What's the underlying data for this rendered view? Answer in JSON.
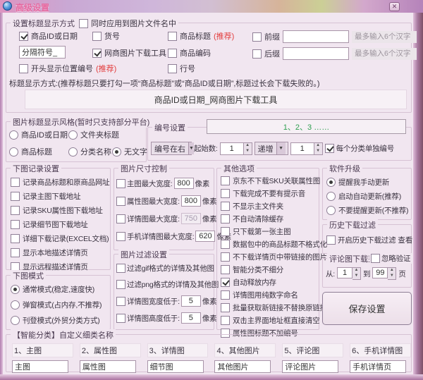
{
  "colors": {
    "accent_red": "#e23b3b",
    "accent_green": "#2e9e4f"
  },
  "window": {
    "title": "高级设置",
    "close_glyph": "✕"
  },
  "g1": {
    "legend": "设置标题显示方式",
    "apply": "同时应用到图片文件名中",
    "r1c1": "商品ID或日期",
    "r1c2": "货号",
    "r1c3": "商品标题",
    "r1rec": "(推荐)",
    "r1c4": "前缀",
    "r1hint": "最多输入6个汉字",
    "r2c1": "分隔符号_",
    "r2c2": "网商图片下载工具",
    "r2c3": "商品编码",
    "r2c4": "后缀",
    "r2hint": "最多输入6个汉字",
    "r3c1": "开头显示位置编号",
    "r3rec": "(推荐)",
    "r3c2": "行号",
    "note": "标题显示方式:(推荐标题只要打勾一项“商品标题”或“商品ID或日期”,标题过长会下载失败的。)",
    "preview": "商品ID或日期_网商图片下载工具"
  },
  "style": {
    "legend": "图片标题显示风格(暂时只支持部分平台)",
    "o1": "商品ID或日期",
    "o2": "文件夹标题",
    "o3": "商品标题",
    "o4": "分类名称",
    "o5": "无文字"
  },
  "num": {
    "legend": "编号设置",
    "preview": "1、2、3 ……",
    "pos": "编号在右",
    "start_label": "起始数:",
    "start": "1",
    "inc": "递增",
    "step": "1",
    "per": "每个分类单独编号"
  },
  "record": {
    "legend": "下图记录设置",
    "items": [
      "记录商品标题和原商品网址",
      "记录主图下载地址",
      "记录SKU属性图下载地址",
      "记录细节图下载地址",
      "详细下载记录(EXCEL文档)",
      "显示本地描述详情页",
      "显示远程描述详情页"
    ]
  },
  "mode": {
    "legend": "下图模式",
    "items": [
      "通常模式(稳定,速度快)",
      "弹窗模式(占内存,不推荐)",
      "刊登模式(外贸分类方式)"
    ]
  },
  "size": {
    "legend": "图片尺寸控制",
    "unit": "像素",
    "l1": "主图最大宽度:",
    "v1": "800",
    "l2": "属性图最大宽度:",
    "v2": "800",
    "l3": "详情图最大宽度:",
    "v3": "750",
    "l4": "手机详情图最大宽度:",
    "v4": "620"
  },
  "filter": {
    "legend": "图片过滤设置",
    "unit": "像素",
    "i1": "过滤gif格式的详情及其他图",
    "i2": "过滤png格式的详情及其他图",
    "l3": "详情图宽度低于:",
    "v3": "5",
    "l4": "详情图高度低于:",
    "v4": "5"
  },
  "other": {
    "legend": "其他选项",
    "items": [
      "京东不下载SKU关联属性图",
      "下载完成不要有提示音",
      "不显示主文件夹",
      "不自动清除缓存",
      "只下载第一张主图",
      "数据包中的商品标题不格式化",
      "不下载详情页中带链接的图片",
      "智能分类不细分",
      "自动释放内存",
      "详情图用纯数字命名",
      "批量获取新链接不替换原链接",
      "双击主界面地址框直接清空",
      "属性图标题不加编号"
    ]
  },
  "upgrade": {
    "legend": "软件升级",
    "o1": "提醒我手动更新",
    "o2": "启动自动更新(推荐)",
    "o3": "不要提醒更新(不推荐)"
  },
  "history": {
    "legend": "历史下载过滤",
    "enable": "开启历史下载过滤",
    "view": "查看"
  },
  "comment": {
    "legend": "评论图下载范围",
    "ignore": "忽略验证",
    "from": "从:",
    "from_v": "1",
    "to": "到",
    "to_v": "99",
    "page": "页"
  },
  "save": "保存设置",
  "smart": {
    "legend": "【智能分类】自定义细类名称",
    "labels": [
      "1、主图",
      "2、属性图",
      "3、详情图",
      "4、其他图片",
      "5、评论图",
      "6、手机详情图"
    ],
    "values": [
      "主图",
      "属性图",
      "细节图",
      "其他图片",
      "评论图片",
      "手机详情页"
    ]
  }
}
